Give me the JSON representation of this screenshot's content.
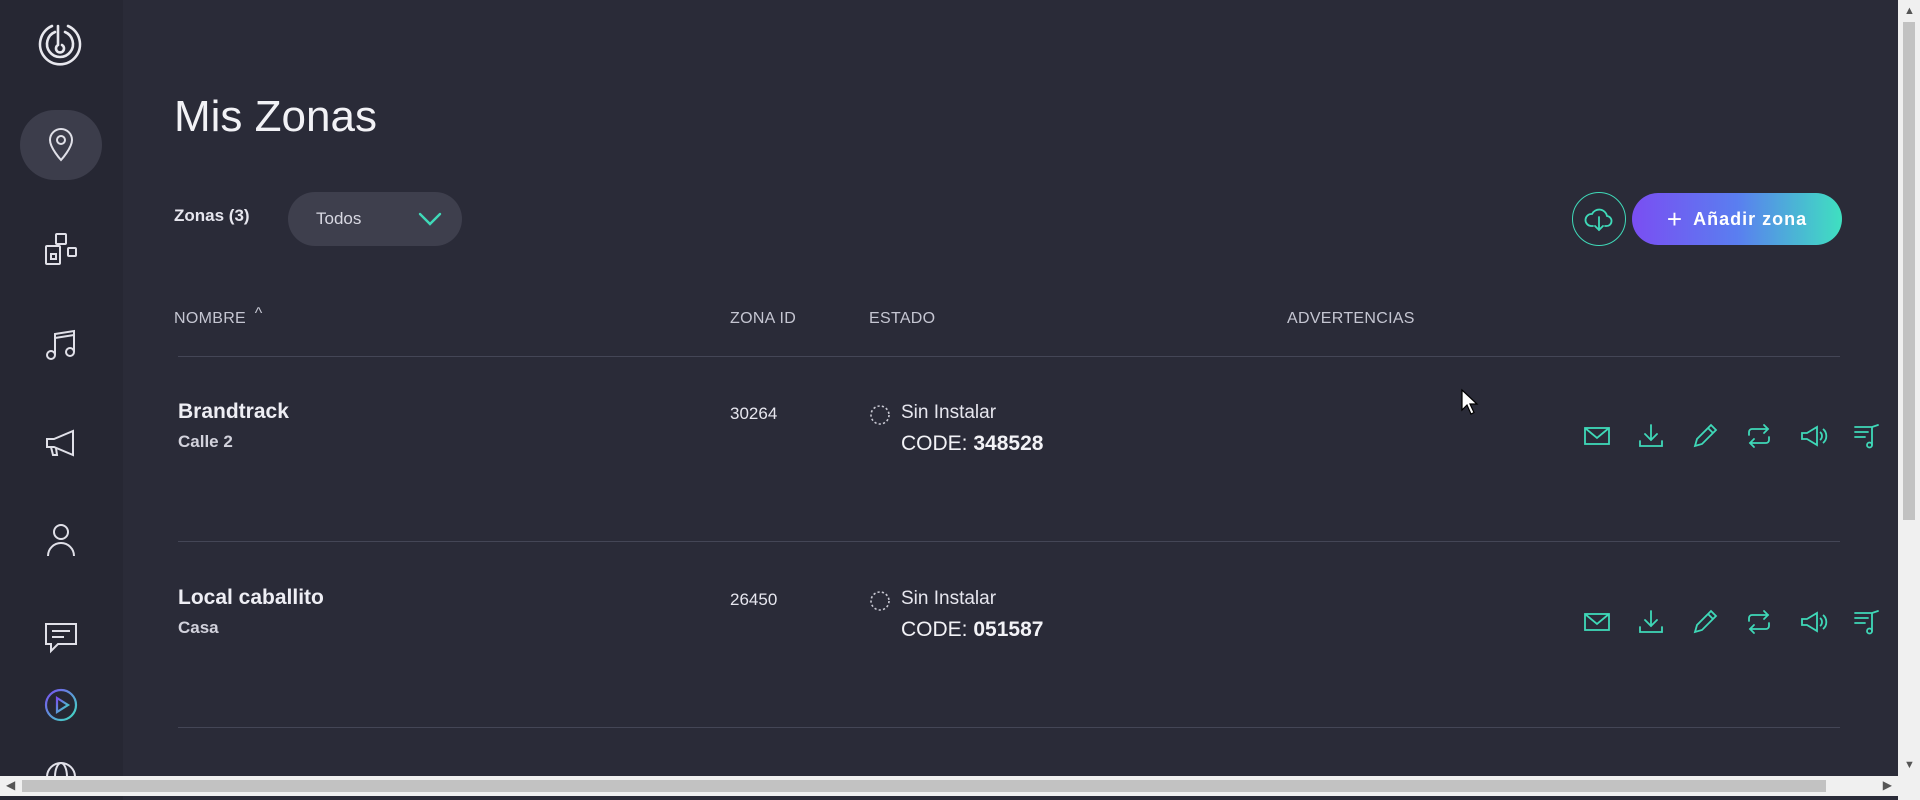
{
  "page": {
    "title": "Mis Zonas"
  },
  "sidebar": {
    "items": [
      {
        "name": "zones",
        "icon": "map-pin-icon",
        "active": true
      },
      {
        "name": "devices",
        "icon": "devices-icon"
      },
      {
        "name": "music",
        "icon": "music-note-icon"
      },
      {
        "name": "announcements",
        "icon": "megaphone-icon"
      },
      {
        "name": "user",
        "icon": "user-icon"
      },
      {
        "name": "messages",
        "icon": "chat-icon"
      },
      {
        "name": "player",
        "icon": "play-circle-icon"
      },
      {
        "name": "web",
        "icon": "globe-icon"
      }
    ]
  },
  "toolbar": {
    "zones_count": "Zonas (3)",
    "filter_value": "Todos",
    "add_label": "Añadir zona",
    "cloud_icon": "cloud-download-icon"
  },
  "table": {
    "headers": {
      "name": "NOMBRE",
      "sort_indicator": "^",
      "zone_id": "ZONA ID",
      "status": "ESTADO",
      "warnings": "ADVERTENCIAS"
    },
    "rows": [
      {
        "name": "Brandtrack",
        "sub": "Calle 2",
        "zone_id": "30264",
        "status": "Sin Instalar",
        "code_label": "CODE:",
        "code": "348528"
      },
      {
        "name": "Local caballito",
        "sub": "Casa",
        "zone_id": "26450",
        "status": "Sin Instalar",
        "code_label": "CODE:",
        "code": "051587"
      }
    ]
  },
  "colors": {
    "accent": "#3fd9b8",
    "background": "#2a2b38",
    "sidebar": "#262733",
    "gradient_start": "#7a4ef2",
    "gradient_end": "#3fe0c0"
  }
}
